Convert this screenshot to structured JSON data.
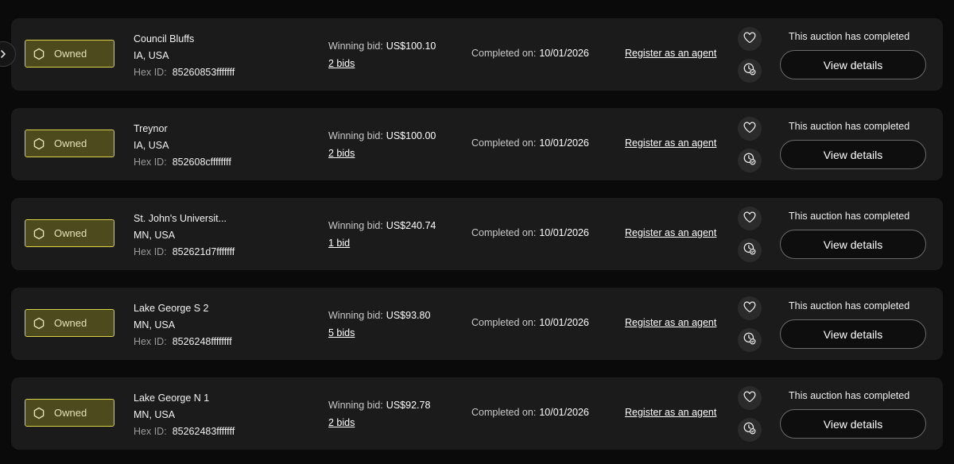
{
  "labels": {
    "owned": "Owned",
    "hex_id": "Hex ID:",
    "winning_bid": "Winning bid:",
    "completed_on": "Completed on:",
    "register": "Register as an agent",
    "status": "This auction has completed",
    "view_details": "View details"
  },
  "icons": {
    "side": "chevron-right-icon",
    "owned": "hexagon-icon",
    "favorite": "heart-icon",
    "watch": "watch-icon"
  },
  "colors": {
    "accent_border": "#d9d24a",
    "accent_fill": "#4d4a1e",
    "card_bg": "#1b1b1b",
    "page_bg": "#0a0a0a"
  },
  "auctions": [
    {
      "name": "Council Bluffs",
      "state": "IA, USA",
      "hex_id": "85260853fffffff",
      "winning_bid": "US$100.10",
      "bids": "2 bids",
      "completed_date": "10/01/2026"
    },
    {
      "name": "Treynor",
      "state": "IA, USA",
      "hex_id": "852608cffffffff",
      "winning_bid": "US$100.00",
      "bids": "2 bids",
      "completed_date": "10/01/2026"
    },
    {
      "name": "St. John's Universit...",
      "state": "MN, USA",
      "hex_id": "852621d7fffffff",
      "winning_bid": "US$240.74",
      "bids": "1 bid",
      "completed_date": "10/01/2026"
    },
    {
      "name": "Lake George S 2",
      "state": "MN, USA",
      "hex_id": "8526248ffffffff",
      "winning_bid": "US$93.80",
      "bids": "5 bids",
      "completed_date": "10/01/2026"
    },
    {
      "name": "Lake George N 1",
      "state": "MN, USA",
      "hex_id": "85262483fffffff",
      "winning_bid": "US$92.78",
      "bids": "2 bids",
      "completed_date": "10/01/2026"
    }
  ]
}
